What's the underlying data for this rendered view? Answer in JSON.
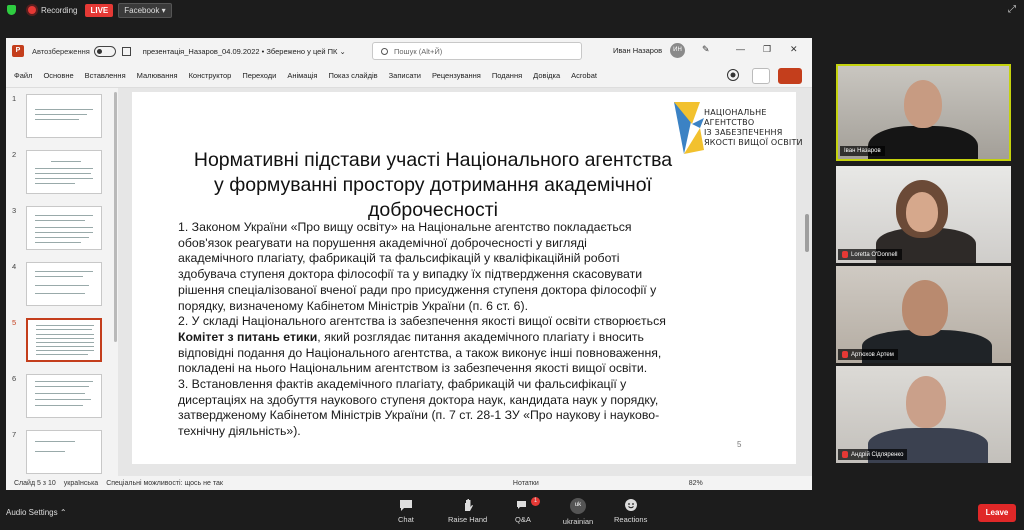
{
  "zoom_top": {
    "recording": "Recording",
    "live": "LIVE",
    "stream_target": "Facebook"
  },
  "ppt": {
    "autosave_label": "Автозбереження",
    "filename": "презентація_Назаров_04.09.2022 • Збережено у цей ПК ⌄",
    "search_placeholder": "Пошук (Alt+Й)",
    "user_name": "Иван Назаров",
    "user_initials": "ИН",
    "ribbon_tabs": [
      "Файл",
      "Основне",
      "Вставлення",
      "Малювання",
      "Конструктор",
      "Переходи",
      "Анімація",
      "Показ слайдів",
      "Записати",
      "Рецензування",
      "Подання",
      "Довідка",
      "Acrobat"
    ],
    "thumb_numbers": [
      "1",
      "2",
      "3",
      "4",
      "5",
      "6",
      "7"
    ],
    "status": {
      "slide_of": "Слайд 5 з 10",
      "language": "українська",
      "accessibility": "Спеціальні можливості: щось не так",
      "notes": "Нотатки",
      "zoom": "82%"
    }
  },
  "slide": {
    "logo_lines": [
      "НАЦІОНАЛЬНЕ",
      "АГЕНТСТВО",
      "ІЗ ЗАБЕЗПЕЧЕННЯ",
      "ЯКОСТІ ВИЩОЇ ОСВІТИ"
    ],
    "title_lines": [
      "Нормативні підстави участі Національного агентства",
      "у формуванні простору дотримання академічної",
      "доброчесності"
    ],
    "p1_lines": [
      "1. Законом України «Про вищу освіту» на Національне агентство покладається",
      "обов'язок реагувати на порушення академічної доброчесності у вигляді",
      "академічного плагіату, фабрикацій та фальсифікацій у кваліфікаційній роботі",
      "здобувача ступеня доктора філософії та у випадку їх підтвердження скасовувати",
      "рішення спеціалізованої вченої ради про присудження ступеня доктора філософії у",
      "порядку, визначеному Кабінетом Міністрів України (п. 6 ст. 6)."
    ],
    "p2_first": " 2. У складі Національного агентства із забезпечення якості вищої освіти створюється",
    "p2_bold": "Комітет з питань етики",
    "p2_bold_rest": ", який розглядає питання академічного плагіату і вносить",
    "p2_lines": [
      "відповідні подання до Національного агентства, а також виконує інші повноваження,",
      "покладені на нього Національним агентством із забезпечення якості вищої освіти."
    ],
    "p3_lines": [
      "3. Встановлення фактів академічного плагіату, фабрикацій чи фальсифікації у",
      "дисертаціях на здобуття наукового ступеня доктора наук, кандидата наук у порядку,",
      "затвердженому Кабінетом Міністрів України (п. 7 ст. 28-1 ЗУ «Про наукову і науково-",
      "технічну діяльність»)."
    ],
    "page_number": "5"
  },
  "participants": [
    {
      "name": "Іван Назаров"
    },
    {
      "name": "Loretta O'Donnell"
    },
    {
      "name": "Артюхов Артем"
    },
    {
      "name": "Андрій Сідляренко"
    }
  ],
  "zoom_bottom": {
    "audio_settings": "Audio Settings ⌃",
    "chat": "Chat",
    "raise_hand": "Raise Hand",
    "qa": "Q&A",
    "qa_badge": "1",
    "language_code": "uk",
    "language": "ukrainian",
    "reactions": "Reactions",
    "leave": "Leave"
  },
  "colors": {
    "accent_red": "#e53935",
    "ppt_orange": "#c43e1c",
    "active_speaker": "#c4d20d",
    "logo_blue": "#3b82c4",
    "logo_yellow": "#f2c12e"
  }
}
